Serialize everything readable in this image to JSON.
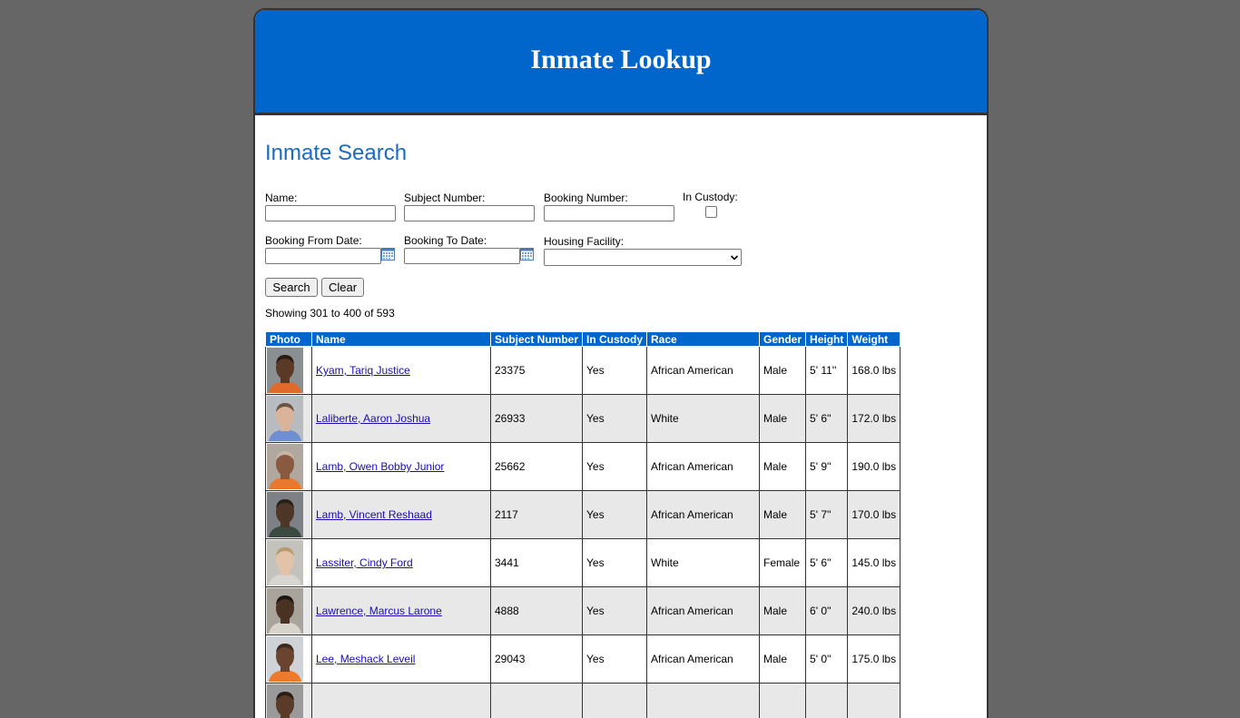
{
  "header": {
    "title": "Inmate Lookup"
  },
  "search": {
    "title": "Inmate Search",
    "name_label": "Name:",
    "subject_number_label": "Subject Number:",
    "booking_number_label": "Booking Number:",
    "in_custody_label": "In Custody:",
    "booking_from_label": "Booking From Date:",
    "booking_to_label": "Booking To Date:",
    "housing_facility_label": "Housing Facility:",
    "search_button": "Search",
    "clear_button": "Clear",
    "name_value": "",
    "subject_number_value": "",
    "booking_number_value": "",
    "booking_from_value": "",
    "booking_to_value": "",
    "housing_facility_value": "",
    "in_custody_checked": false
  },
  "results": {
    "summary": "Showing 301 to 400 of 593",
    "headers": [
      "Photo",
      "Name",
      "Subject Number",
      "In Custody",
      "Race",
      "Gender",
      "Height",
      "Weight"
    ],
    "rows": [
      {
        "name": "Kyam, Tariq Justice",
        "subject_number": "23375",
        "in_custody": "Yes",
        "race": "African American",
        "gender": "Male",
        "height": "5' 11''",
        "weight": "168.0 lbs",
        "photo": {
          "bg": "#8a8f92",
          "skin": "#5a3a26",
          "hair": "#2a1a12",
          "shirt": "#e06a2a"
        }
      },
      {
        "name": "Laliberte, Aaron Joshua",
        "subject_number": "26933",
        "in_custody": "Yes",
        "race": "White",
        "gender": "Male",
        "height": "5' 6''",
        "weight": "172.0 lbs",
        "photo": {
          "bg": "#b8bcc0",
          "skin": "#d9b49a",
          "hair": "#6b5544",
          "shirt": "#6f8fd0"
        }
      },
      {
        "name": "Lamb, Owen Bobby Junior",
        "subject_number": "25662",
        "in_custody": "Yes",
        "race": "African American",
        "gender": "Male",
        "height": "5' 9''",
        "weight": "190.0 lbs",
        "photo": {
          "bg": "#b0a89e",
          "skin": "#8a5a40",
          "hair": "#c9b5a5",
          "shirt": "#e8782e"
        }
      },
      {
        "name": "Lamb, Vincent Reshaad",
        "subject_number": "2117",
        "in_custody": "Yes",
        "race": "African American",
        "gender": "Male",
        "height": "5' 7''",
        "weight": "170.0 lbs",
        "photo": {
          "bg": "#7d8085",
          "skin": "#4e3626",
          "hair": "#2b2018",
          "shirt": "#3a4a40"
        }
      },
      {
        "name": "Lassiter, Cindy Ford",
        "subject_number": "3441",
        "in_custody": "Yes",
        "race": "White",
        "gender": "Female",
        "height": "5' 6''",
        "weight": "145.0 lbs",
        "photo": {
          "bg": "#c4c2bc",
          "skin": "#e2c2a8",
          "hair": "#b89a6e",
          "shirt": "#d8d6d0"
        }
      },
      {
        "name": "Lawrence, Marcus Larone",
        "subject_number": "4888",
        "in_custody": "Yes",
        "race": "African American",
        "gender": "Male",
        "height": "6' 0''",
        "weight": "240.0 lbs",
        "photo": {
          "bg": "#a8a49c",
          "skin": "#4a3222",
          "hair": "#1e1610",
          "shirt": "#d8d4cc"
        }
      },
      {
        "name": "Lee, Meshack Leveil",
        "subject_number": "29043",
        "in_custody": "Yes",
        "race": "African American",
        "gender": "Male",
        "height": "5' 0''",
        "weight": "175.0 lbs",
        "photo": {
          "bg": "#cfd2d6",
          "skin": "#6b4430",
          "hair": "#3a2a20",
          "shirt": "#f07a28"
        }
      },
      {
        "name": "",
        "subject_number": "",
        "in_custody": "",
        "race": "",
        "gender": "",
        "height": "",
        "weight": "",
        "photo": {
          "bg": "#9a9a9a",
          "skin": "#5a3a28",
          "hair": "#2a1c14",
          "shirt": "#888888"
        }
      }
    ]
  },
  "icons": {
    "calendar": "calendar-icon",
    "dropdown": "chevron-down-icon"
  },
  "colors": {
    "banner": "#0066cc",
    "page_bg": "#666666",
    "title_text": "#1a6bbf",
    "link": "#1a0dab",
    "alt_row": "#e8e8e8"
  }
}
